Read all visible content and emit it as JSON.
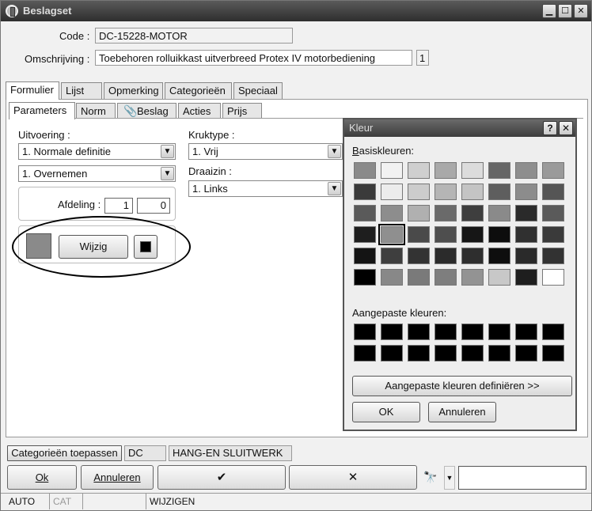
{
  "window": {
    "title": "Beslagset"
  },
  "header": {
    "code_label": "Code :",
    "code_value": "DC-15228-MOTOR",
    "desc_label": "Omschrijving :",
    "desc_value": "Toebehoren rolluikkast uitverbreed Protex IV motorbediening",
    "desc_count": "1"
  },
  "tabs": [
    "Formulier",
    "Lijst",
    "Opmerking",
    "Categorieën",
    "Speciaal"
  ],
  "subtabs": [
    "Parameters",
    "Norm",
    "Beslag",
    "Acties",
    "Prijs"
  ],
  "form": {
    "uitvoering_label": "Uitvoering :",
    "uitvoering_value": "1.  Normale definitie",
    "overnemen_value": "1.  Overnemen",
    "afdeling_label": "Afdeling :",
    "afdeling_val1": "1",
    "afdeling_val2": "0",
    "wijzig_label": "Wijzig",
    "kruktype_label": "Kruktype :",
    "kruktype_value": "1.  Vrij",
    "draaizin_label": "Draaizin :",
    "draaizin_value": "1.  Links"
  },
  "dialog": {
    "title": "Kleur",
    "basic_label": "Basiskleuren:",
    "custom_label": "Aangepaste kleuren:",
    "define_button": "Aangepaste kleuren definiëren >>",
    "ok_button": "OK",
    "cancel_button": "Annuleren",
    "basic_colors": [
      "#8a8a8a",
      "#f2f2f2",
      "#cfcfcf",
      "#a9a9a9",
      "#dcdcdc",
      "#666666",
      "#8e8e8e",
      "#9a9a9a",
      "#3a3a3a",
      "#ececec",
      "#cccccc",
      "#b5b5b5",
      "#c4c4c4",
      "#5e5e5e",
      "#8c8c8c",
      "#555555",
      "#5a5a5a",
      "#8d8d8d",
      "#b0b0b0",
      "#6a6a6a",
      "#3e3e3e",
      "#8a8a8a",
      "#2a2a2a",
      "#5a5a5a",
      "#1e1e1e",
      "#8f8f8f",
      "#4a4a4a",
      "#4e4e4e",
      "#161616",
      "#0d0d0d",
      "#303030",
      "#3a3a3a",
      "#141414",
      "#3e3e3e",
      "#333333",
      "#2b2b2b",
      "#2e2e2e",
      "#0e0e0e",
      "#2a2a2a",
      "#323232",
      "#000000",
      "#888888",
      "#7a7a7a",
      "#7e7e7e",
      "#939393",
      "#c8c8c8",
      "#1e1e1e",
      "#ffffff"
    ],
    "selected_index": 25,
    "custom_colors_count": 16,
    "custom_color": "#000000"
  },
  "footer": {
    "categorieen_button": "Categorieën toepassen",
    "cat_code": "DC",
    "cat_name": "HANG-EN SLUITWERK",
    "ok_button": "Ok",
    "cancel_button": "Annuleren",
    "check_symbol": "✔",
    "cross_symbol": "✕"
  },
  "status": {
    "mode": "AUTO",
    "cat": "CAT",
    "action": "WIJZIGEN"
  }
}
